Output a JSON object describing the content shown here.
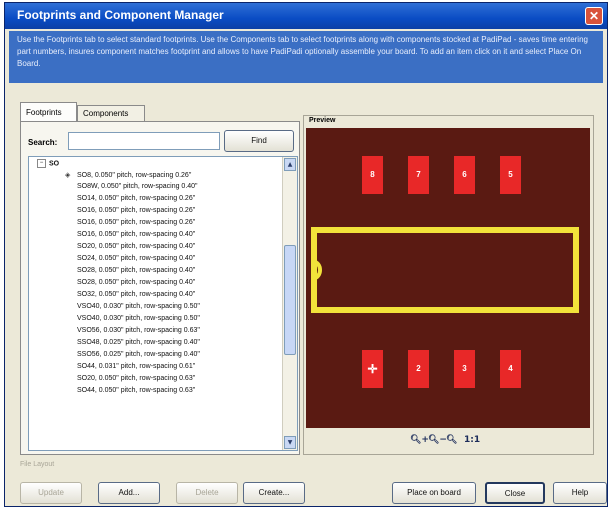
{
  "window": {
    "title": "Footprints and Component Manager",
    "close_glyph": "✕"
  },
  "info_text": "Use the Footprints tab to select standard footprints. Use the Components tab to select footprints along with components stocked at PadiPad - saves time entering part numbers, insures component matches footprint and allows to have PadiPadi optionally assemble your board. To add an item click on it and select Place On Board.",
  "tabs": [
    {
      "label": "Footprints",
      "selected": true
    },
    {
      "label": "Components",
      "selected": false
    }
  ],
  "search": {
    "label": "Search:",
    "value": "",
    "placeholder": "",
    "find_label": "Find"
  },
  "footprint_tree": {
    "group_label": "SO",
    "group_expander": "−",
    "selected_marker": "◈",
    "items": [
      "SO8, 0.050\" pitch, row-spacing 0.26\"",
      "SO8W, 0.050\" pitch, row-spacing 0.40\"",
      "SO14, 0.050\" pitch, row-spacing 0.26\"",
      "SO16, 0.050\" pitch, row-spacing 0.26\"",
      "SO16, 0.050\" pitch, row-spacing 0.26\"",
      "SO16, 0.050\" pitch, row-spacing 0.40\"",
      "SO20, 0.050\" pitch, row-spacing 0.40\"",
      "SO24, 0.050\" pitch, row-spacing 0.40\"",
      "SO28, 0.050\" pitch, row-spacing 0.40\"",
      "SO28, 0.050\" pitch, row-spacing 0.40\"",
      "SO32, 0.050\" pitch, row-spacing 0.40\"",
      "VSO40, 0.030\" pitch, row-spacing 0.50\"",
      "VSO40, 0.030\" pitch, row-spacing 0.50\"",
      "VSO56, 0.030\" pitch, row-spacing 0.63\"",
      "SSO48, 0.025\" pitch, row-spacing 0.40\"",
      "SSO56, 0.025\" pitch, row-spacing 0.40\"",
      "SO44, 0.031\" pitch, row-spacing 0.61\"",
      "SO20, 0.050\" pitch, row-spacing 0.63\"",
      "SO44, 0.050\" pitch, row-spacing 0.63\""
    ]
  },
  "preview": {
    "label": "Preview",
    "background_color": "#5a1a12",
    "pad_color": "#e82828",
    "outline_color": "#f2e23a",
    "pins_top": [
      "8",
      "7",
      "6",
      "5"
    ],
    "pins_bottom": [
      "1",
      "2",
      "3",
      "4"
    ],
    "pin1_marker": "✛",
    "zoom_controls": [
      {
        "icon": "zoom-in-icon",
        "glyph": "🔍︎+"
      },
      {
        "icon": "zoom-out-icon",
        "glyph": "🔍︎−"
      },
      {
        "icon": "zoom-fit-icon",
        "glyph": "🔍︎"
      },
      {
        "icon": "zoom-actual-icon",
        "glyph": "1:1"
      }
    ]
  },
  "file_label": "File Layout",
  "buttons": {
    "update": "Update",
    "add": "Add...",
    "delete": "Delete",
    "create": "Create...",
    "place_on_board": "Place on board",
    "close": "Close",
    "help": "Help"
  }
}
